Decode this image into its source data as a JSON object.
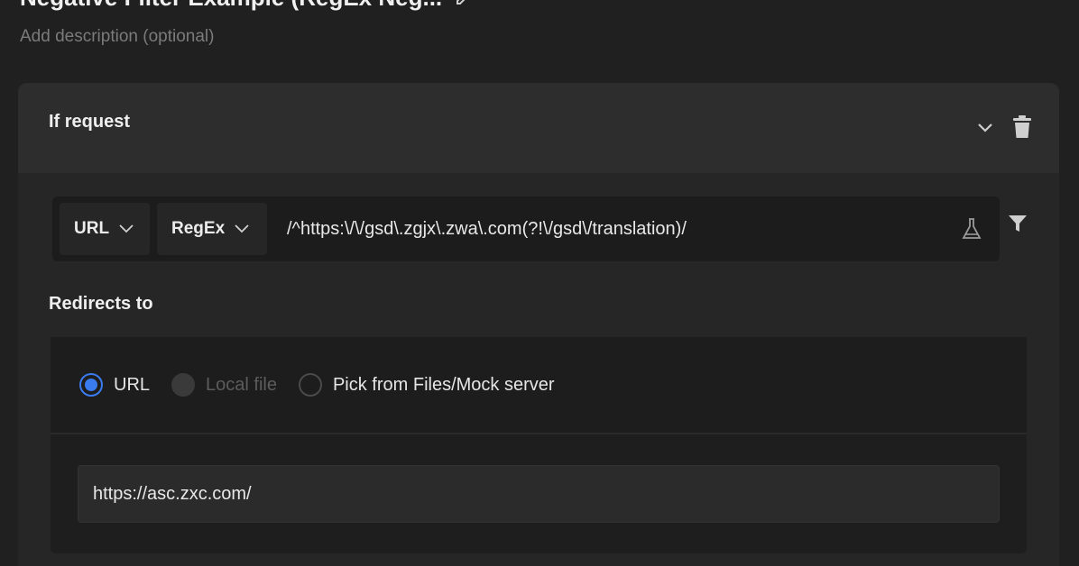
{
  "rule": {
    "title": "Negative Filter Example (RegEx Neg...",
    "description_placeholder": "Add description (optional)"
  },
  "condition": {
    "section_label": "If request",
    "source_field": "URL",
    "operator": "RegEx",
    "value": "/^https:\\/\\/gsd\\.zgjx\\.zwa\\.com(?!\\/gsd\\/translation)/"
  },
  "redirect": {
    "section_label": "Redirects to",
    "options": [
      {
        "label": "URL",
        "checked": true,
        "disabled": false
      },
      {
        "label": "Local file",
        "checked": false,
        "disabled": true
      },
      {
        "label": "Pick from Files/Mock server",
        "checked": false,
        "disabled": false
      }
    ],
    "url_value": "https://asc.zxc.com/"
  },
  "icons": {
    "edit": "pencil-icon",
    "collapse": "chevron-down-icon",
    "delete": "trash-icon",
    "test": "flask-icon",
    "filter": "filter-icon"
  },
  "colors": {
    "accent": "#3a7bf0",
    "background": "#202020"
  }
}
